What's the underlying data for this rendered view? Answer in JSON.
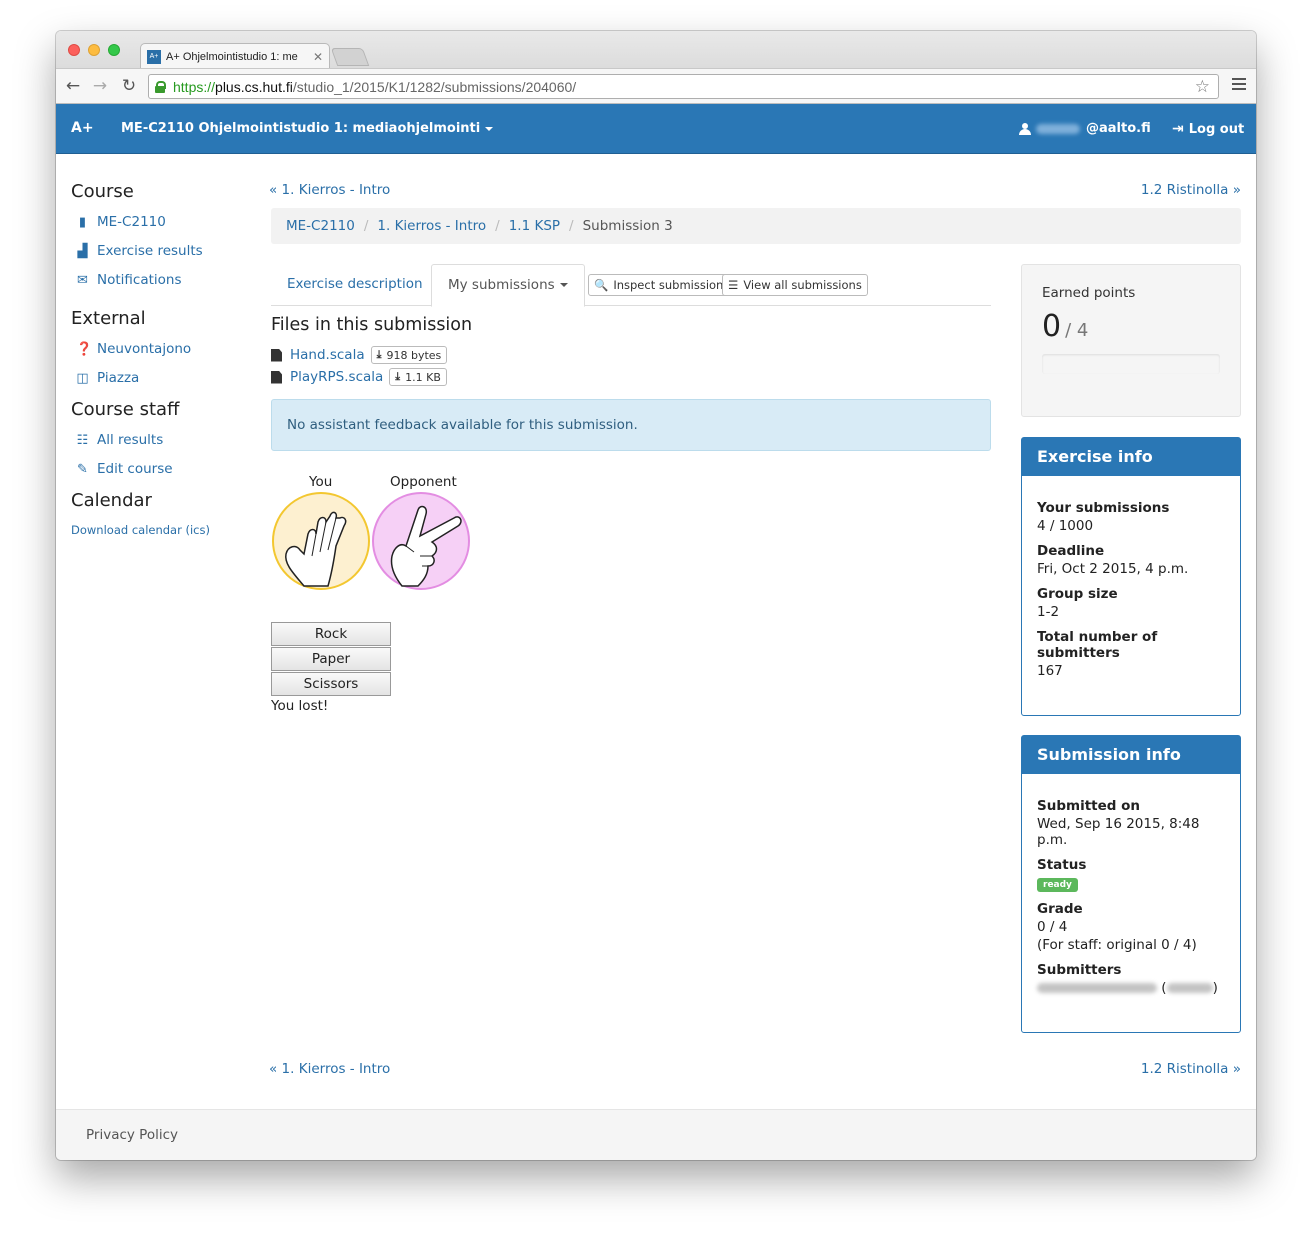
{
  "browser": {
    "tab_title": "A+ Ohjelmointistudio 1: me",
    "favicon_text": "A+",
    "url_scheme": "https://",
    "url_host": "plus.cs.hut.fi",
    "url_path": "/studio_1/2015/K1/1282/submissions/204060/"
  },
  "navbar": {
    "brand": "A+",
    "course": "ME-C2110 Ohjelmointistudio 1: mediaohjelmointi",
    "user_email_suffix": "@aalto.fi",
    "logout": "Log out"
  },
  "sidebar": {
    "course_heading": "Course",
    "course_items": [
      {
        "label": "ME-C2110",
        "icon": "book-icon"
      },
      {
        "label": "Exercise results",
        "icon": "bar-chart-icon"
      },
      {
        "label": "Notifications",
        "icon": "envelope-icon"
      }
    ],
    "external_heading": "External",
    "external_items": [
      {
        "label": "Neuvontajono",
        "icon": "question-circle-icon"
      },
      {
        "label": "Piazza",
        "icon": "inbox-icon"
      }
    ],
    "staff_heading": "Course staff",
    "staff_items": [
      {
        "label": "All results",
        "icon": "list-icon"
      },
      {
        "label": "Edit course",
        "icon": "pencil-icon"
      }
    ],
    "calendar_heading": "Calendar",
    "calendar_link": "Download calendar (ics)"
  },
  "pager": {
    "prev": "« 1. Kierros - Intro",
    "next": "1.2 Ristinolla »"
  },
  "breadcrumb": {
    "items": [
      "ME-C2110",
      "1. Kierros - Intro",
      "1.1 KSP"
    ],
    "separator": "/",
    "active": "Submission 3"
  },
  "tabs": {
    "description": "Exercise description",
    "my_submissions": "My submissions",
    "inspect": "Inspect submission",
    "view_all": "View all submissions"
  },
  "files": {
    "heading": "Files in this submission",
    "items": [
      {
        "name": "Hand.scala",
        "size": "918 bytes"
      },
      {
        "name": "PlayRPS.scala",
        "size": "1.1 KB"
      }
    ]
  },
  "alert": "No assistant feedback available for this submission.",
  "game": {
    "you_label": "You",
    "opponent_label": "Opponent",
    "buttons": [
      "Rock",
      "Paper",
      "Scissors"
    ],
    "result": "You lost!",
    "colors": {
      "you_fill": "#fdf0d0",
      "you_stroke": "#f3c730",
      "opp_fill": "#f6d0f6",
      "opp_stroke": "#e38de2"
    }
  },
  "points": {
    "label": "Earned points",
    "earned": "0",
    "max": "/ 4",
    "progress": 0
  },
  "exercise_info": {
    "title": "Exercise info",
    "rows": [
      {
        "label": "Your submissions",
        "value": "4 / 1000"
      },
      {
        "label": "Deadline",
        "value": "Fri, Oct 2 2015, 4 p.m."
      },
      {
        "label": "Group size",
        "value": "1-2"
      },
      {
        "label": "Total number of submitters",
        "value": "167"
      }
    ]
  },
  "submission_info": {
    "title": "Submission info",
    "submitted_label": "Submitted on",
    "submitted_value": "Wed, Sep 16 2015, 8:48 p.m.",
    "status_label": "Status",
    "status_value": "ready",
    "grade_label": "Grade",
    "grade_value": "0 / 4",
    "grade_note": "(For staff: original 0 / 4)",
    "submitters_label": "Submitters"
  },
  "footer": {
    "privacy": "Privacy Policy"
  },
  "colors": {
    "brand_blue": "#2a77b5",
    "link": "#2a6fa8",
    "alert_bg": "#d8ebf6",
    "ready_green": "#5cb85c"
  }
}
